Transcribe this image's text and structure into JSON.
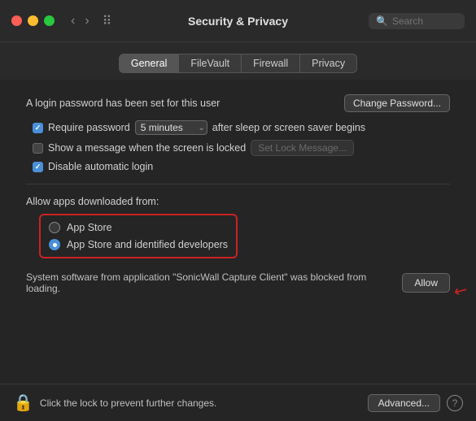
{
  "titlebar": {
    "title": "Security & Privacy",
    "search_placeholder": "Search",
    "nav_back": "‹",
    "nav_forward": "›",
    "grid_icon": "⠿"
  },
  "tabs": [
    {
      "id": "general",
      "label": "General",
      "active": true
    },
    {
      "id": "filevault",
      "label": "FileVault",
      "active": false
    },
    {
      "id": "firewall",
      "label": "Firewall",
      "active": false
    },
    {
      "id": "privacy",
      "label": "Privacy",
      "active": false
    }
  ],
  "general": {
    "password_row": {
      "label": "A login password has been set for this user",
      "button": "Change Password..."
    },
    "require_password": {
      "label_before": "Require password",
      "dropdown_value": "5 minutes",
      "label_after": "after sleep or screen saver begins",
      "checked": true
    },
    "show_message": {
      "label": "Show a message when the screen is locked",
      "button": "Set Lock Message...",
      "checked": false
    },
    "disable_login": {
      "label": "Disable automatic login",
      "checked": true
    },
    "allow_apps": {
      "section_label": "Allow apps downloaded from:",
      "options": [
        {
          "id": "app-store",
          "label": "App Store",
          "selected": false
        },
        {
          "id": "app-store-identified",
          "label": "App Store and identified developers",
          "selected": true
        }
      ]
    },
    "blocked_software": {
      "text": "System software from application \"SonicWall Capture Client\" was blocked from loading.",
      "button": "Allow"
    }
  },
  "bottombar": {
    "lock_label": "Click the lock to prevent further changes.",
    "advanced_button": "Advanced...",
    "help_button": "?"
  }
}
